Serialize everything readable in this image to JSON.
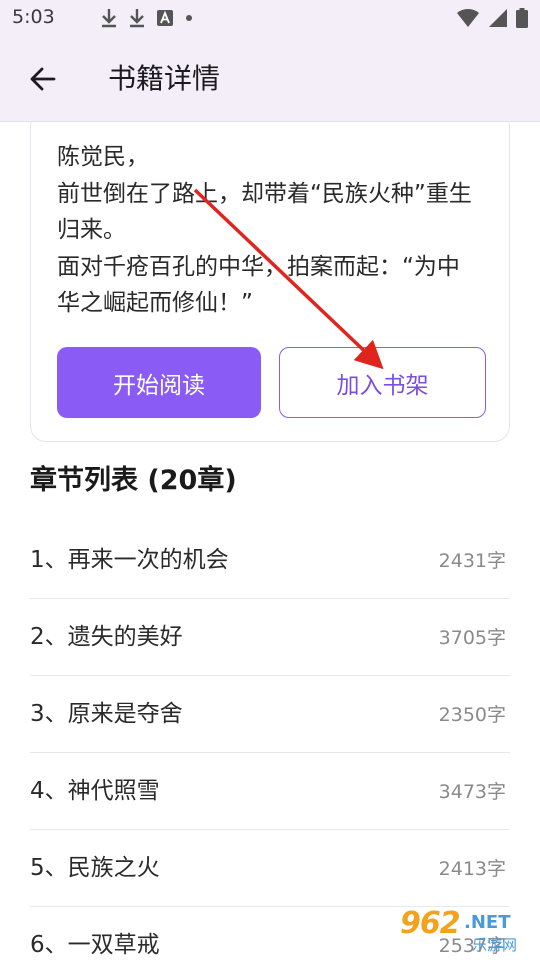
{
  "status_bar": {
    "time": "5:03",
    "left_icons": [
      "download-icon",
      "download-icon",
      "a-notification-icon",
      "dot-icon"
    ],
    "right_icons": [
      "wifi-icon",
      "signal-icon",
      "battery-icon"
    ]
  },
  "app_bar": {
    "back_icon": "arrow-left-icon",
    "title": "书籍详情"
  },
  "book": {
    "intro_lines": [
      "陈觉民，",
      "前世倒在了路上，却带着“民族火种”重生",
      "归来。",
      "面对千疮百孔的中华，拍案而起：“为中",
      "华之崛起而修仙！”"
    ],
    "read_button": "开始阅读",
    "shelf_button": "加入书架"
  },
  "chapters": {
    "heading": "章节列表 (20章)",
    "items": [
      {
        "title": "1、再来一次的机会",
        "count": "2431字"
      },
      {
        "title": "2、遗失的美好",
        "count": "3705字"
      },
      {
        "title": "3、原来是夺舍",
        "count": "2350字"
      },
      {
        "title": "4、神代照雪",
        "count": "3473字"
      },
      {
        "title": "5、民族之火",
        "count": "2413字"
      },
      {
        "title": "6、一双草戒",
        "count": "2537字"
      }
    ]
  },
  "watermark": {
    "number": "962",
    "suffix": ".NET",
    "chinese": "乐游网"
  },
  "colors": {
    "accent": "#8a5cf5",
    "app_bar_bg": "#f3eef8",
    "arrow": "#e0241e"
  }
}
